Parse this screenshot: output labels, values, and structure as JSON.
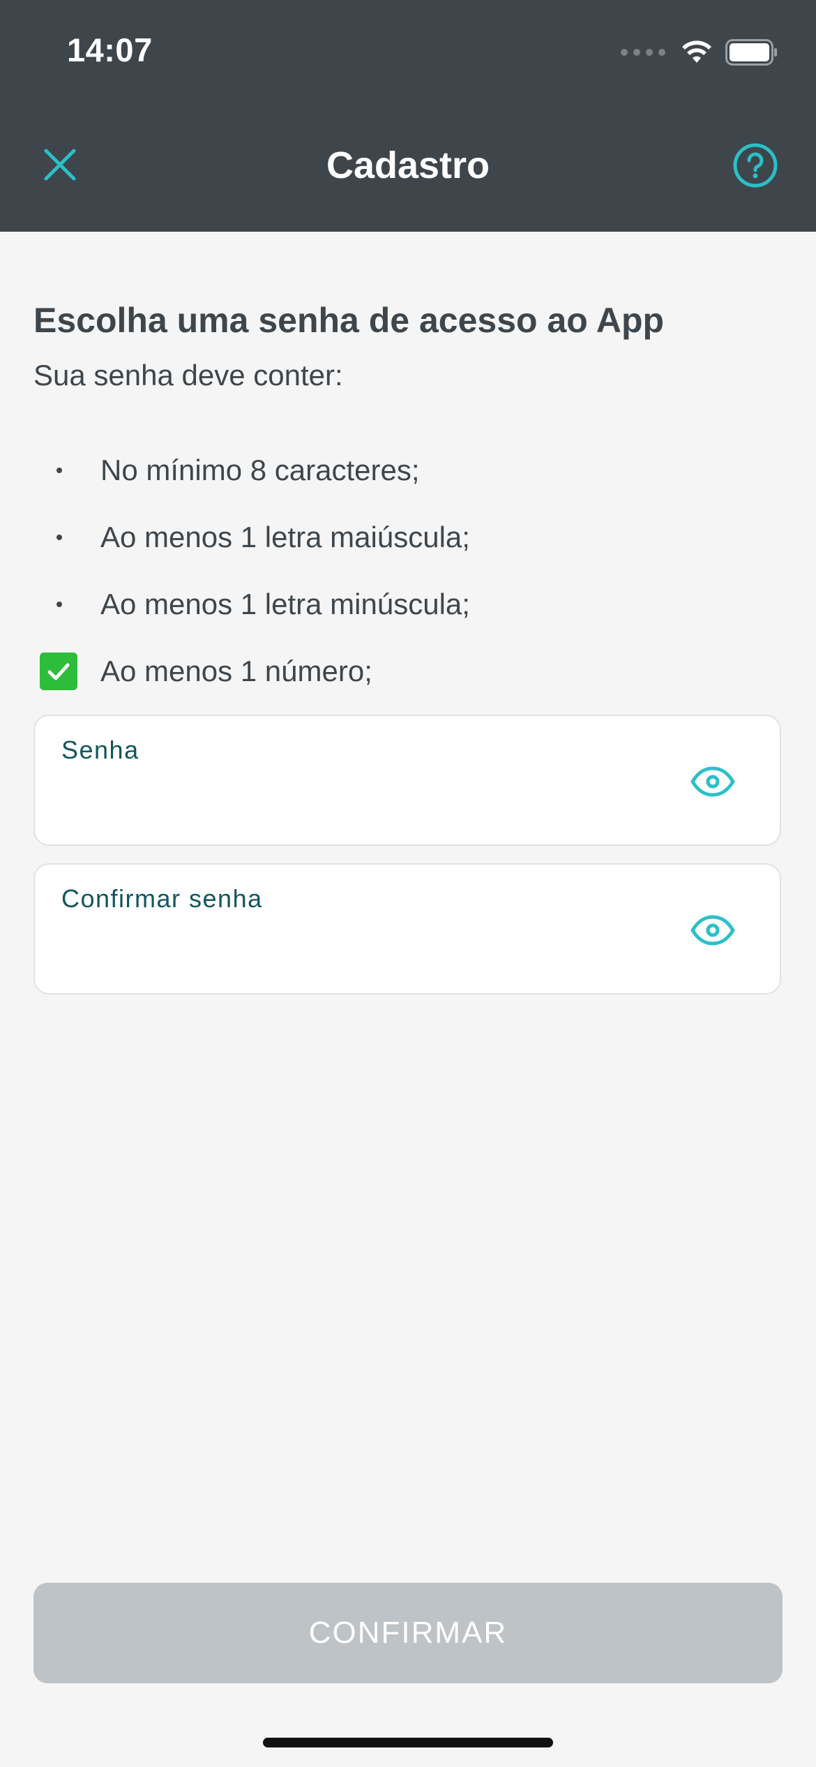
{
  "status_bar": {
    "time": "14:07",
    "icons": [
      "cellular-signal-icon",
      "wifi-icon",
      "battery-icon"
    ]
  },
  "header": {
    "title": "Cadastro",
    "close_icon": "close-icon",
    "help_icon": "help-icon",
    "background_color": "#3e464c",
    "accent_color": "#2bc0c8"
  },
  "content": {
    "heading": "Escolha uma senha de acesso ao App",
    "subheading": "Sua senha deve conter:",
    "requirements": [
      {
        "label": "No mínimo 8 caracteres;",
        "met": false
      },
      {
        "label": "Ao menos 1 letra maiúscula;",
        "met": false
      },
      {
        "label": "Ao menos 1 letra minúscula;",
        "met": false
      },
      {
        "label": "Ao menos 1 número;",
        "met": true
      }
    ],
    "check_color": "#2dbd3b"
  },
  "form": {
    "password": {
      "label": "Senha",
      "value": ""
    },
    "confirm_password": {
      "label": "Confirmar senha",
      "value": ""
    },
    "visibility_icon": "eye-icon"
  },
  "actions": {
    "confirm_label": "CONFIRMAR",
    "confirm_enabled": false,
    "disabled_color": "#bdc3c7"
  }
}
